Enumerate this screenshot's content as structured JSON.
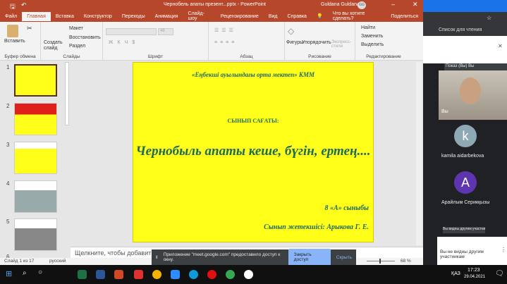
{
  "window": {
    "title": "Чернобель апаты презент...pptx  -  PowerPoint",
    "user": "Guldana Guldana",
    "user_initials": "GG"
  },
  "tabs": [
    "Файл",
    "Главная",
    "Вставка",
    "Конструктор",
    "Переходы",
    "Анимация",
    "Слайд-шоу",
    "Рецензирование",
    "Вид",
    "Справка"
  ],
  "tell_me": "Что вы хотите сделать?",
  "share": "Поделиться",
  "ribbon": {
    "paste": "Вставить",
    "clipboard": "Буфер обмена",
    "new_slide": "Создать слайд",
    "layout": "Макет",
    "reset": "Восстановить",
    "section": "Раздел",
    "slides": "Слайды",
    "font": "Шрифт",
    "font_size": "48",
    "paragraph": "Абзац",
    "shapes": "Фигуры",
    "arrange": "Упорядочить",
    "quick_styles": "Экспресс-стили",
    "drawing": "Рисование",
    "find": "Найти",
    "replace": "Заменить",
    "select": "Выделить",
    "editing": "Редактирование"
  },
  "thumbs": [
    "1",
    "2",
    "3",
    "4",
    "5",
    "6"
  ],
  "slide": {
    "school": "«Еңбекші ауылындағы орта мектеп» КММ",
    "subtitle": "СЫНЫП САҒАТЫ:",
    "title": "Чернобыль апаты кеше, бүгін, ертең....",
    "class": "8 «А» сыныбы",
    "teacher": "Сынып жетекшісі: Арыкова Г. Е."
  },
  "notes_placeholder": "Щелкните, чтобы добавить заметки",
  "status": {
    "slide": "Слайд 1 из 17",
    "lang": "русский",
    "zoom": "68 %"
  },
  "share_bar": {
    "message": "Приложение \"meet.google.com\" предоставило доступ к окну.",
    "stop": "Закрыть доступ",
    "hide": "Скрыть"
  },
  "meet": {
    "reading_list": "Список для чтения",
    "presenting": "Показ (Вы)",
    "you_short": "Вы",
    "you_label": "Вы",
    "participants": [
      {
        "initial": "k",
        "name": "kamila aidarbekova",
        "color": "#8fa9b4"
      },
      {
        "initial": "A",
        "name": "Арайлым Серикқызы",
        "color": "#5e35b1"
      }
    ],
    "visible_badge": "Вы видны другим участникам",
    "visible_note": "Вы не видны другим участникам"
  },
  "taskbar": {
    "lang": "ҚАЗ",
    "time": "17:23",
    "date": "29.04.2021"
  }
}
